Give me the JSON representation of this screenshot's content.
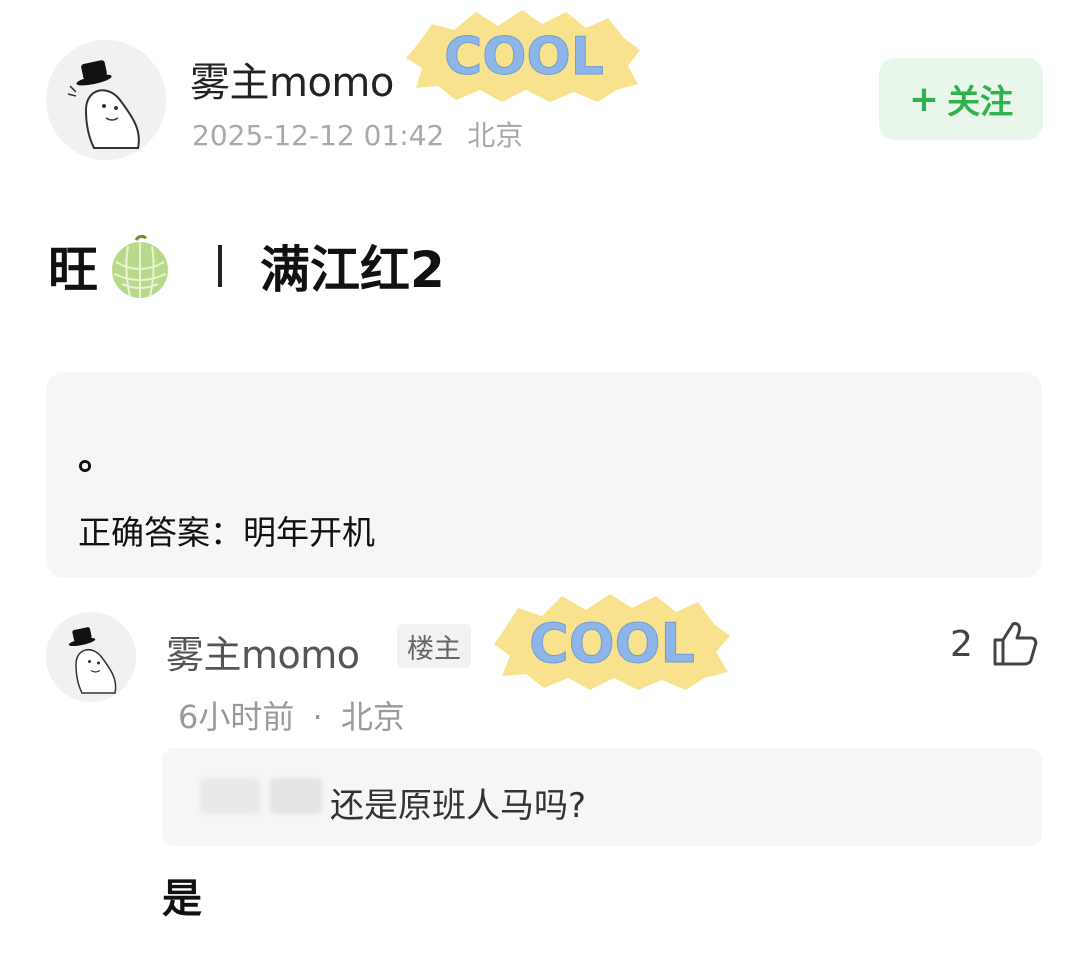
{
  "post": {
    "author": {
      "name": "雾主momo",
      "avatar_icon": "hat-ghost-avatar-icon",
      "badge_text": "COOL"
    },
    "timestamp": "2025-12-12 01:42",
    "location": "北京",
    "follow_label": "关注",
    "follow_icon": "plus-icon",
    "title_prefix": "旺",
    "title_emoji_icon": "melon-emoji-icon",
    "title_text": "满江红2",
    "content": {
      "line1": "。",
      "line2": "正确答案：明年开机"
    }
  },
  "comment": {
    "author": {
      "name": "雾主momo",
      "op_badge": "楼主",
      "badge_text": "COOL",
      "avatar_icon": "hat-ghost-avatar-icon"
    },
    "likes": "2",
    "like_icon": "thumbs-up-icon",
    "time": "6小时前",
    "separator": "·",
    "location": "北京",
    "quoted_text": "还是原班人马吗?",
    "reply": "是"
  },
  "colors": {
    "accent_green": "#2fb24e",
    "follow_bg": "#e9f7ea",
    "card_bg": "#f6f6f6",
    "meta_gray": "#a9a9a9"
  }
}
